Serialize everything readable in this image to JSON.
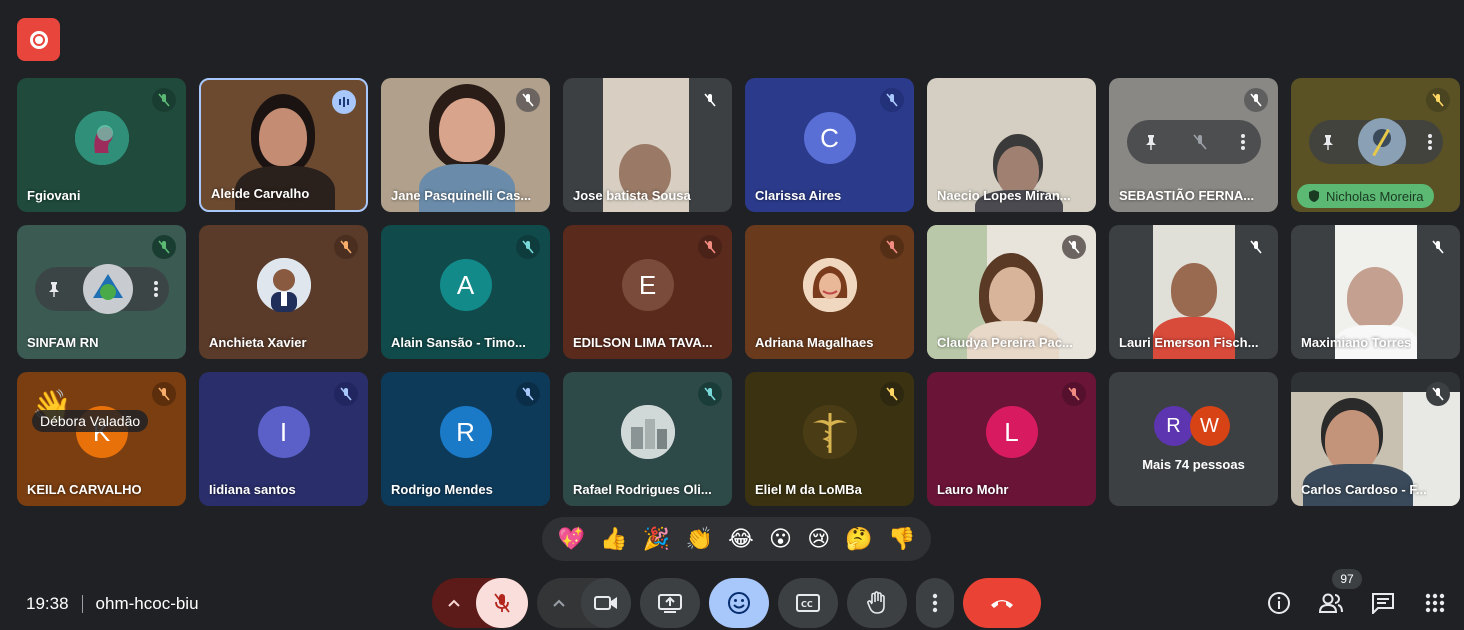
{
  "meeting": {
    "time": "19:38",
    "code": "ohm-hcoc-biu"
  },
  "participants": [
    {
      "name": "Fgiovani"
    },
    {
      "name": "Aleide Carvalho"
    },
    {
      "name": "Jane Pasquinelli Cas..."
    },
    {
      "name": "Jose batista Sousa"
    },
    {
      "name": "Clarissa Aires",
      "initial": "C"
    },
    {
      "name": "Naecio Lopes Miran..."
    },
    {
      "name": "SEBASTIÃO FERNA..."
    },
    {
      "name": "Nicholas Moreira"
    },
    {
      "name": "SINFAM RN"
    },
    {
      "name": "Anchieta Xavier"
    },
    {
      "name": "Alain Sansão - Timo...",
      "initial": "A"
    },
    {
      "name": "EDILSON LIMA TAVA...",
      "initial": "E"
    },
    {
      "name": "Adriana Magalhaes"
    },
    {
      "name": "Claudya Pereira Pac..."
    },
    {
      "name": "Lauri Emerson Fisch..."
    },
    {
      "name": "Maximiano Torres"
    },
    {
      "name": "KEILA CARVALHO",
      "initial": "K"
    },
    {
      "name": "Iidiana santos",
      "initial": "I"
    },
    {
      "name": "Rodrigo Mendes",
      "initial": "R"
    },
    {
      "name": "Rafael Rodrigues Oli..."
    },
    {
      "name": "Eliel M da LoMBa"
    },
    {
      "name": "Lauro Mohr",
      "initial": "L"
    },
    {
      "name": "Carlos Cardoso - F..."
    }
  ],
  "more": {
    "label": "Mais 74 pessoas",
    "avatars": [
      "R",
      "W"
    ]
  },
  "hand_raise_label": "Débora Valadão",
  "reactions": [
    "💖",
    "👍",
    "🎉",
    "👏",
    "😂",
    "😮",
    "😢",
    "🤔",
    "👎"
  ],
  "people_count": "97",
  "colors": {
    "background": "#202124",
    "end_call": "#ea4335",
    "emoji_active": "#a8c7fa"
  }
}
